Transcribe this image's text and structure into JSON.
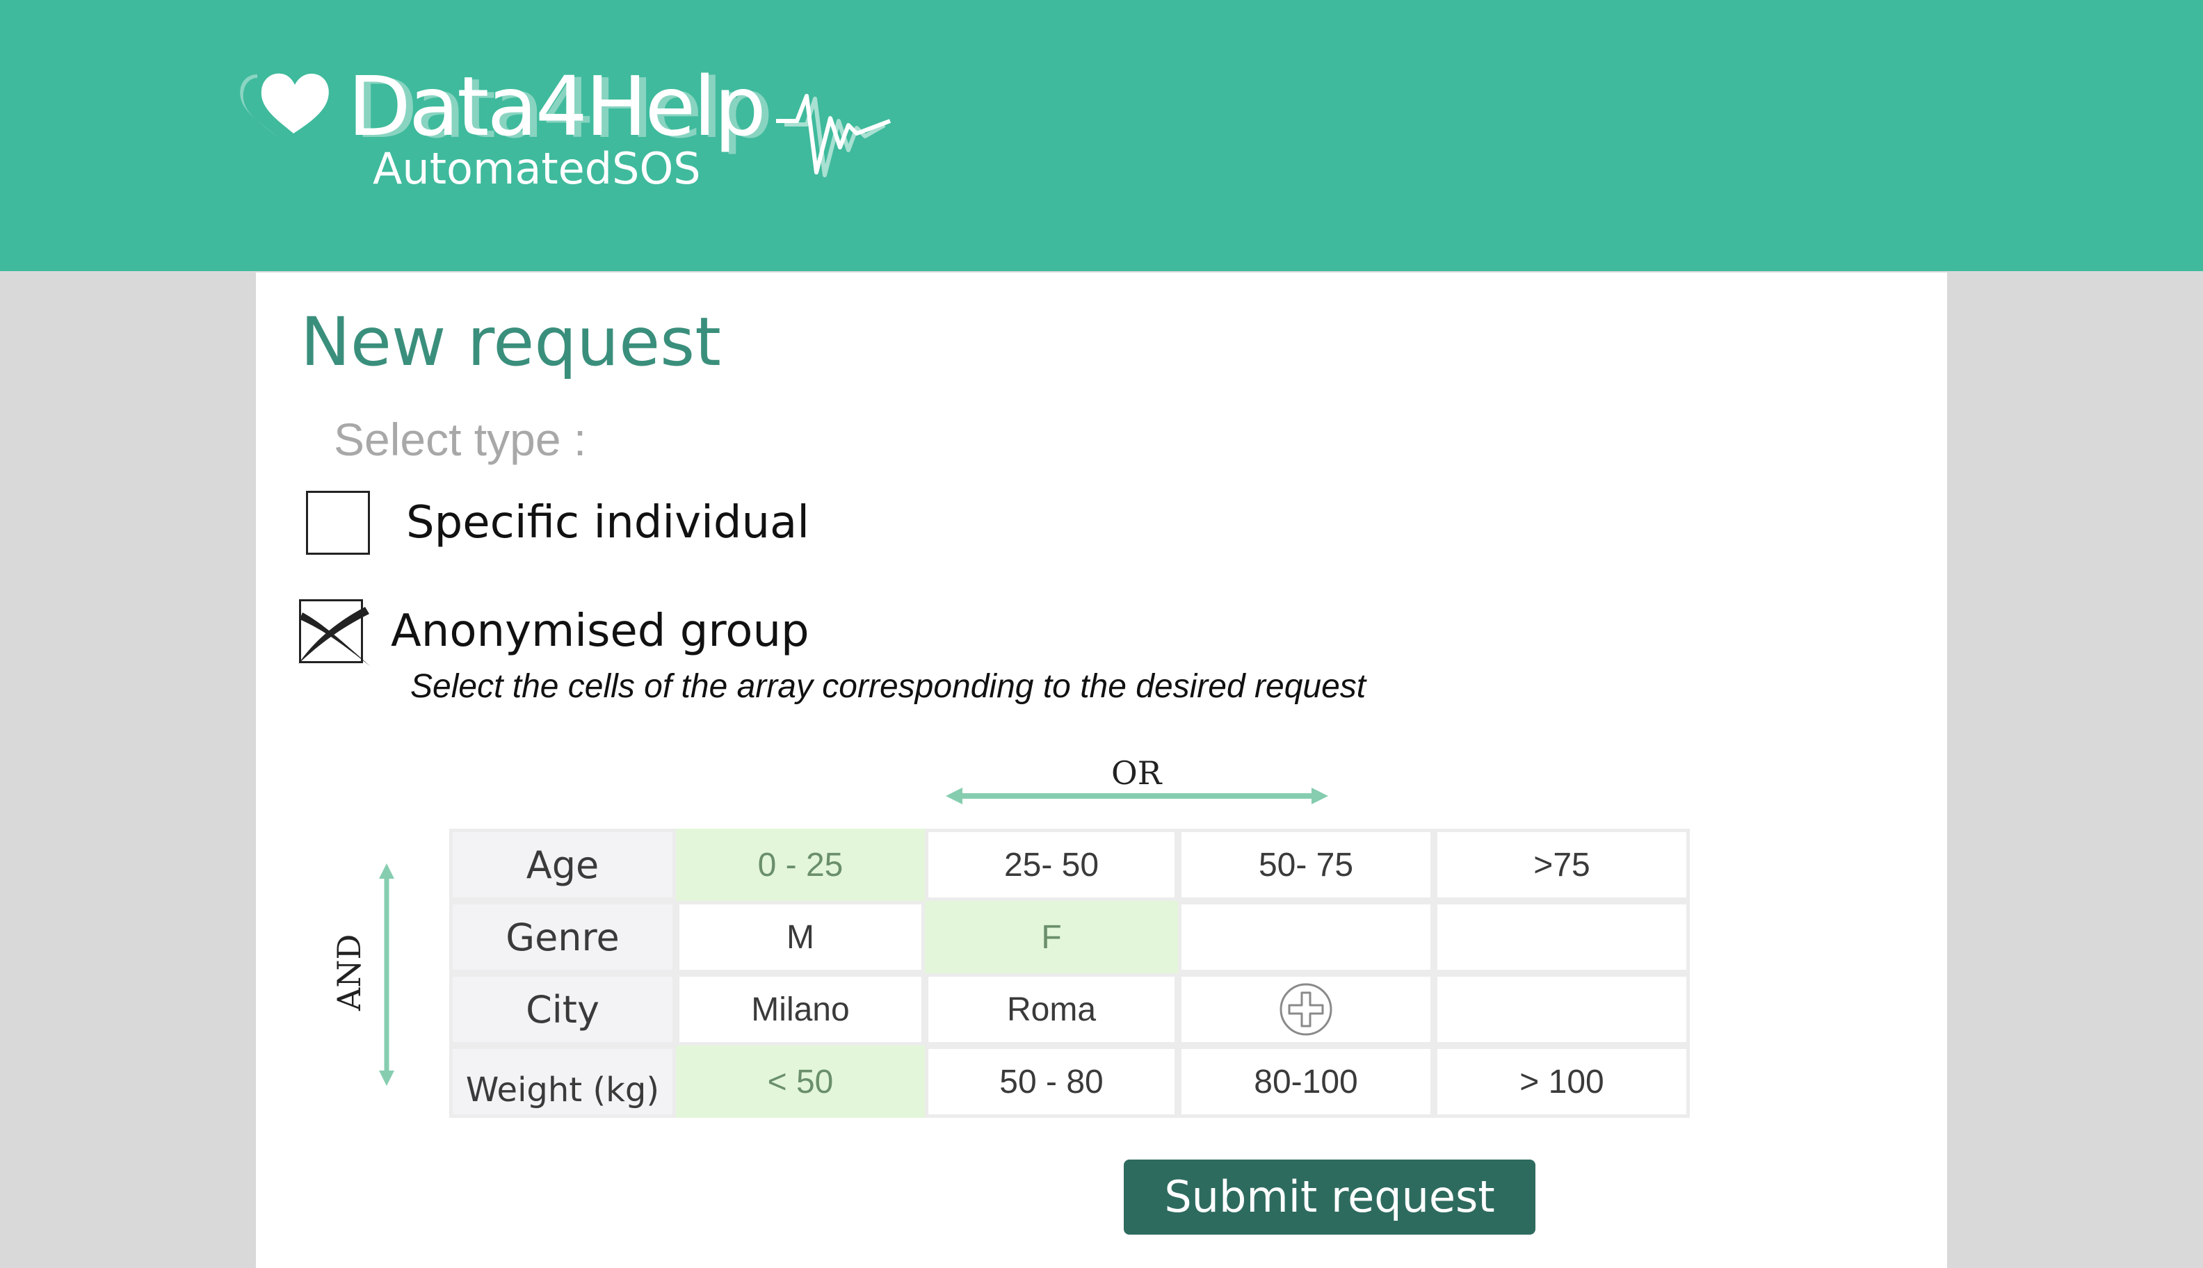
{
  "brand": {
    "name": "Data4Help",
    "tagline": "AutomatedSOS",
    "logo_icon": "heart-icon",
    "pulse_icon": "heartbeat-pulse-icon",
    "header_color": "#3fba9c"
  },
  "page": {
    "title": "New request",
    "select_type_label": "Select type :"
  },
  "options": {
    "individual": {
      "label": "Specific individual",
      "checked": false
    },
    "group": {
      "label": "Anonymised group",
      "checked": true
    }
  },
  "instruction": "Select the cells of the array corresponding to the desired request",
  "grid": {
    "or_label": "OR",
    "and_label": "AND",
    "rows": [
      {
        "header": "Age",
        "cells": [
          "0 - 25",
          "25- 50",
          "50- 75",
          ">75"
        ],
        "selected": [
          true,
          false,
          false,
          false
        ]
      },
      {
        "header": "Genre",
        "cells": [
          "M",
          "F",
          "",
          ""
        ],
        "selected": [
          false,
          true,
          false,
          false
        ]
      },
      {
        "header": "City",
        "cells": [
          "Milano",
          "Roma",
          "",
          ""
        ],
        "selected": [
          false,
          false,
          false,
          false
        ],
        "add_icon": "plus-circle-icon"
      },
      {
        "header": "Weight (kg)",
        "cells": [
          "< 50",
          "50 - 80",
          "80-100",
          "> 100"
        ],
        "selected": [
          true,
          false,
          false,
          false
        ]
      }
    ],
    "selected_color": "#e3f6da",
    "arrow_color": "#86cdb0"
  },
  "submit": {
    "label": "Submit request",
    "color": "#2e6b5f"
  }
}
